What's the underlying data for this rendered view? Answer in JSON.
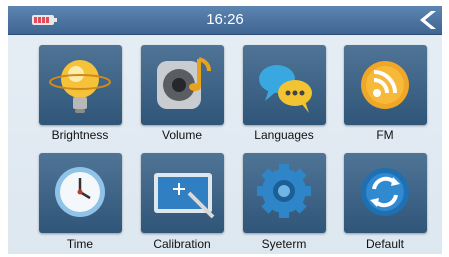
{
  "status": {
    "time": "16:26"
  },
  "menu": [
    {
      "label": "Brightness",
      "icon": "brightness-icon"
    },
    {
      "label": "Volume",
      "icon": "volume-icon"
    },
    {
      "label": "Languages",
      "icon": "languages-icon"
    },
    {
      "label": "FM",
      "icon": "fm-icon"
    },
    {
      "label": "Time",
      "icon": "time-icon"
    },
    {
      "label": "Calibration",
      "icon": "calibration-icon"
    },
    {
      "label": "Syeterm",
      "icon": "system-icon"
    },
    {
      "label": "Default",
      "icon": "default-icon"
    }
  ],
  "colors": {
    "statusbar": "#4a6f9c",
    "tile": "#3b6284",
    "background": "#e3ebf3",
    "battery_level": "#e24b5b"
  }
}
